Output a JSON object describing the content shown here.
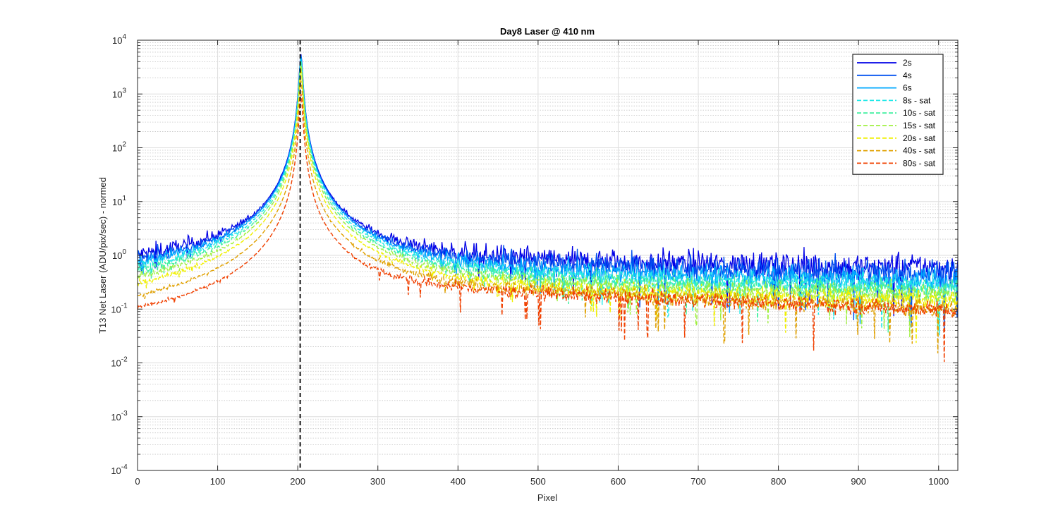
{
  "chart_data": {
    "type": "line",
    "title": "Day8 Laser @ 410 nm",
    "xlabel": "Pixel",
    "ylabel": "T13 Net Laser (ADU/pix/sec) - normed",
    "xlim": [
      0,
      1024
    ],
    "ylim_exponents": [
      -4,
      4
    ],
    "yscale": "log",
    "xticks": [
      "0",
      "100",
      "200",
      "300",
      "400",
      "500",
      "600",
      "700",
      "800",
      "900",
      "1000"
    ],
    "yticks": [
      "-4",
      "-3",
      "-2",
      "-1",
      "0",
      "1",
      "2",
      "3",
      "4"
    ],
    "ytick_base": "10",
    "grid": true,
    "legend_position": "top-right",
    "vline": {
      "x": 203,
      "style": "dashed",
      "color": "#000000"
    },
    "peak": {
      "x": 204,
      "width": 3.2
    },
    "series": [
      {
        "name": "2s",
        "color": "#0000e6",
        "style": "solid",
        "peak": 5500,
        "base_left": 0.7,
        "base_right": 0.7,
        "noise": 0.32,
        "shoulder": 0
      },
      {
        "name": "4s",
        "color": "#0050f0",
        "style": "solid",
        "peak": 5200,
        "base_left": 0.55,
        "base_right": 0.55,
        "noise": 0.3,
        "shoulder": 0
      },
      {
        "name": "6s",
        "color": "#00a8ff",
        "style": "solid",
        "peak": 5000,
        "base_left": 0.42,
        "base_right": 0.4,
        "noise": 0.28,
        "shoulder": 0
      },
      {
        "name": "8s - sat",
        "color": "#20e8e8",
        "style": "dashed",
        "peak": 4500,
        "base_left": 0.33,
        "base_right": 0.32,
        "noise": 0.27,
        "shoulder": 0
      },
      {
        "name": "10s - sat",
        "color": "#40f0a0",
        "style": "dashed",
        "peak": 4000,
        "base_left": 0.25,
        "base_right": 0.26,
        "noise": 0.26,
        "shoulder": 0
      },
      {
        "name": "15s - sat",
        "color": "#a0f040",
        "style": "dashed",
        "peak": 3500,
        "base_left": 0.17,
        "base_right": 0.21,
        "noise": 0.25,
        "shoulder": 0
      },
      {
        "name": "20s - sat",
        "color": "#f0f000",
        "style": "dashed",
        "peak": 2800,
        "base_left": 0.11,
        "base_right": 0.17,
        "noise": 0.24,
        "shoulder": 0
      },
      {
        "name": "40s - sat",
        "color": "#e0a000",
        "style": "dashed",
        "peak": 1800,
        "base_left": 0.045,
        "base_right": 0.2,
        "noise": 0.22,
        "shoulder": 1
      },
      {
        "name": "80s - sat",
        "color": "#f04000",
        "style": "dashed",
        "peak": 1000,
        "base_left": 0.035,
        "base_right": 0.2,
        "noise": 0.18,
        "shoulder": 1
      }
    ]
  }
}
